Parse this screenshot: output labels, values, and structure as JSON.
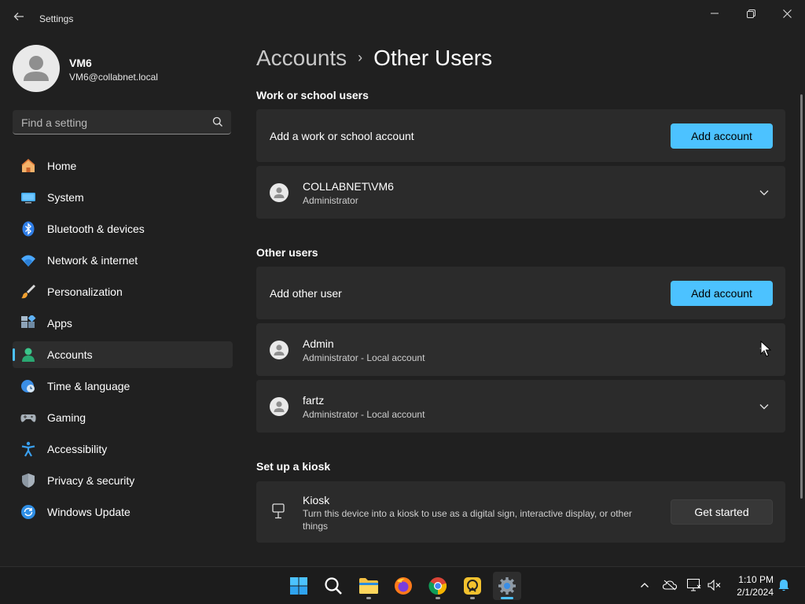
{
  "window": {
    "title": "Settings"
  },
  "user": {
    "name": "VM6",
    "email": "VM6@collabnet.local"
  },
  "search": {
    "placeholder": "Find a setting"
  },
  "nav": [
    {
      "label": "Home",
      "icon": "home-icon",
      "active": false
    },
    {
      "label": "System",
      "icon": "system-icon",
      "active": false
    },
    {
      "label": "Bluetooth & devices",
      "icon": "bluetooth-icon",
      "active": false
    },
    {
      "label": "Network & internet",
      "icon": "network-icon",
      "active": false
    },
    {
      "label": "Personalization",
      "icon": "brush-icon",
      "active": false
    },
    {
      "label": "Apps",
      "icon": "apps-icon",
      "active": false
    },
    {
      "label": "Accounts",
      "icon": "accounts-icon",
      "active": true
    },
    {
      "label": "Time & language",
      "icon": "time-language-icon",
      "active": false
    },
    {
      "label": "Gaming",
      "icon": "gaming-icon",
      "active": false
    },
    {
      "label": "Accessibility",
      "icon": "accessibility-icon",
      "active": false
    },
    {
      "label": "Privacy & security",
      "icon": "shield-icon",
      "active": false
    },
    {
      "label": "Windows Update",
      "icon": "update-icon",
      "active": false
    }
  ],
  "breadcrumb": {
    "parent": "Accounts",
    "separator": "›",
    "current": "Other Users"
  },
  "work": {
    "section_title": "Work or school users",
    "add_label": "Add a work or school account",
    "add_button": "Add account",
    "users": [
      {
        "name": "COLLABNET\\VM6",
        "role": "Administrator"
      }
    ]
  },
  "other": {
    "section_title": "Other users",
    "add_label": "Add other user",
    "add_button": "Add account",
    "users": [
      {
        "name": "Admin",
        "role": "Administrator - Local account"
      },
      {
        "name": "fartz",
        "role": "Administrator - Local account"
      }
    ]
  },
  "kiosk": {
    "section_title": "Set up a kiosk",
    "title": "Kiosk",
    "description_line1": "Turn this device into a kiosk to use as a digital sign, interactive display, or other",
    "description_line2": "things",
    "button": "Get started"
  },
  "taskbar": {
    "apps": [
      "start-icon",
      "search-icon",
      "file-explorer-icon",
      "firefox-icon",
      "chrome-icon",
      "remote-app-icon",
      "settings-app-icon"
    ],
    "time": "1:10 PM",
    "date": "2/1/2024"
  },
  "colors": {
    "accent": "#4cc2ff",
    "background": "#202020",
    "card": "#2b2b2b"
  }
}
